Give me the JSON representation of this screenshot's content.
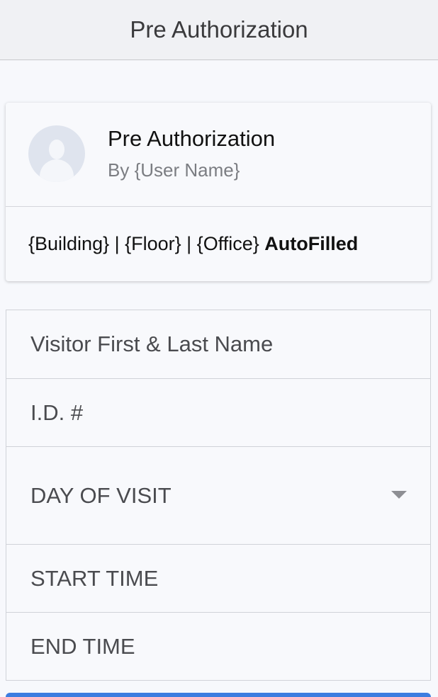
{
  "navbar": {
    "title": "Pre Authorization"
  },
  "card": {
    "title": "Pre Authorization",
    "subtitle": "By {User Name}",
    "location": "{Building} | {Floor} | {Office}",
    "location_note": "AutoFilled"
  },
  "form": {
    "visitor_name_placeholder": "Visitor First & Last Name",
    "id_placeholder": "I.D. #",
    "day_of_visit_label": "DAY OF VISIT",
    "start_time_label": "START TIME",
    "end_time_label": "END TIME"
  },
  "colors": {
    "accent": "#3d7de0",
    "background": "#f7f8fc"
  },
  "icons": {
    "avatar": "user-placeholder-icon",
    "dropdown": "caret-down-icon"
  }
}
